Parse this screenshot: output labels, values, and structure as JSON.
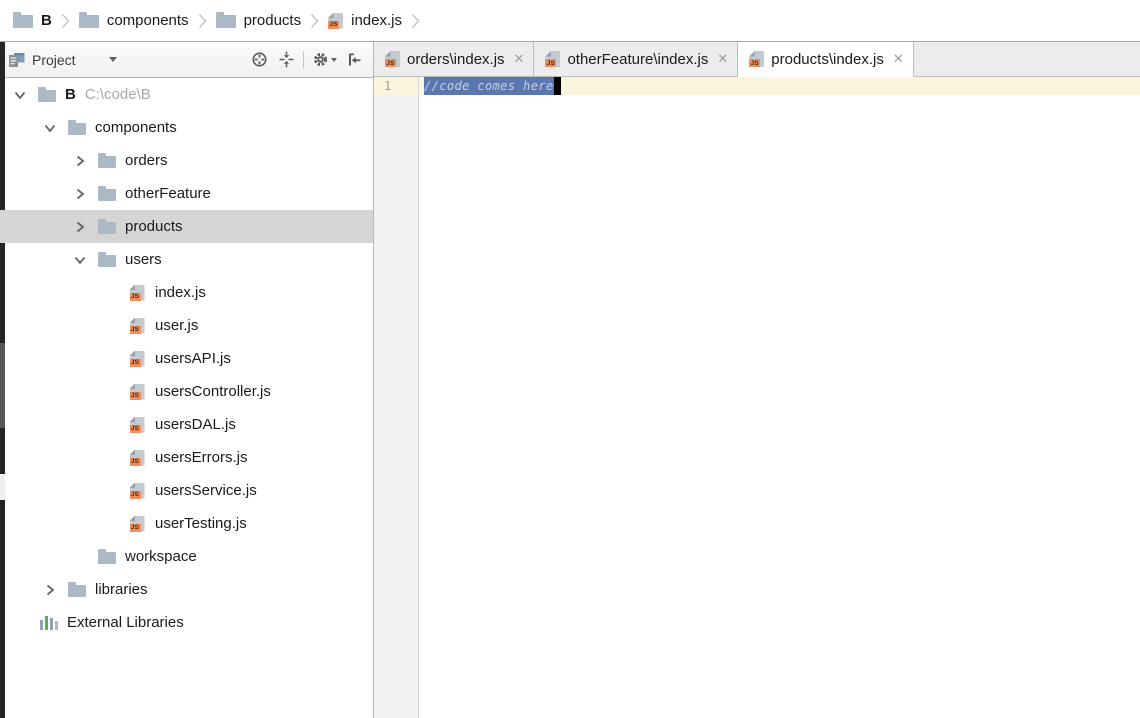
{
  "breadcrumb": {
    "items": [
      {
        "label": "B",
        "icon": "folder",
        "bold": true
      },
      {
        "label": "components",
        "icon": "folder",
        "bold": false
      },
      {
        "label": "products",
        "icon": "folder",
        "bold": false
      },
      {
        "label": "index.js",
        "icon": "js",
        "bold": false
      }
    ]
  },
  "project_panel": {
    "title": "Project",
    "toolbar_icons": [
      "locate-icon",
      "collapse-all-icon",
      "settings-gear-icon",
      "hide-panel-icon"
    ],
    "tree": [
      {
        "label": "B",
        "path_suffix": "C:\\code\\B",
        "level": 0,
        "icon": "folder",
        "chevron": "expanded",
        "bold": true,
        "selected": false
      },
      {
        "label": "components",
        "level": 1,
        "icon": "folder",
        "chevron": "expanded",
        "bold": false,
        "selected": false
      },
      {
        "label": "orders",
        "level": 2,
        "icon": "folder",
        "chevron": "collapsed",
        "bold": false,
        "selected": false
      },
      {
        "label": "otherFeature",
        "level": 2,
        "icon": "folder",
        "chevron": "collapsed",
        "bold": false,
        "selected": false
      },
      {
        "label": "products",
        "level": 2,
        "icon": "folder",
        "chevron": "collapsed",
        "bold": false,
        "selected": true
      },
      {
        "label": "users",
        "level": 2,
        "icon": "folder",
        "chevron": "expanded",
        "bold": false,
        "selected": false
      },
      {
        "label": "index.js",
        "level": 3,
        "icon": "js",
        "chevron": "blank",
        "bold": false,
        "selected": false
      },
      {
        "label": "user.js",
        "level": 3,
        "icon": "js",
        "chevron": "blank",
        "bold": false,
        "selected": false
      },
      {
        "label": "usersAPI.js",
        "level": 3,
        "icon": "js",
        "chevron": "blank",
        "bold": false,
        "selected": false
      },
      {
        "label": "usersController.js",
        "level": 3,
        "icon": "js",
        "chevron": "blank",
        "bold": false,
        "selected": false
      },
      {
        "label": "usersDAL.js",
        "level": 3,
        "icon": "js",
        "chevron": "blank",
        "bold": false,
        "selected": false
      },
      {
        "label": "usersErrors.js",
        "level": 3,
        "icon": "js",
        "chevron": "blank",
        "bold": false,
        "selected": false
      },
      {
        "label": "usersService.js",
        "level": 3,
        "icon": "js",
        "chevron": "blank",
        "bold": false,
        "selected": false
      },
      {
        "label": "userTesting.js",
        "level": 3,
        "icon": "js",
        "chevron": "blank",
        "bold": false,
        "selected": false
      },
      {
        "label": "workspace",
        "level": 2,
        "icon": "folder",
        "chevron": "blank",
        "bold": false,
        "selected": false
      },
      {
        "label": "libraries",
        "level": 1,
        "icon": "folder",
        "chevron": "collapsed",
        "bold": false,
        "selected": false
      },
      {
        "label": "External Libraries",
        "level": 1,
        "icon": "ext-lib",
        "chevron": "none",
        "bold": false,
        "selected": false
      }
    ]
  },
  "editor": {
    "tabs": [
      {
        "label": "orders\\index.js",
        "active": false
      },
      {
        "label": "otherFeature\\index.js",
        "active": false
      },
      {
        "label": "products\\index.js",
        "active": true
      }
    ],
    "line_numbers": [
      "1"
    ],
    "code_line": "//code comes here"
  },
  "icons": {
    "js_badge_text": "JS",
    "tab_close_glyph": "✕"
  },
  "colors": {
    "selection_bg": "#5A77AE",
    "selection_text": "#C9D0DE",
    "caret_row_bg": "#FCF5DD",
    "tree_selection_bg": "#D5D5D5",
    "js_badge": "#EF8E5D",
    "folder_icon": "#ABB9C7",
    "tab_border": "#BDBDBD",
    "panel_border": "#B9B9B9"
  }
}
